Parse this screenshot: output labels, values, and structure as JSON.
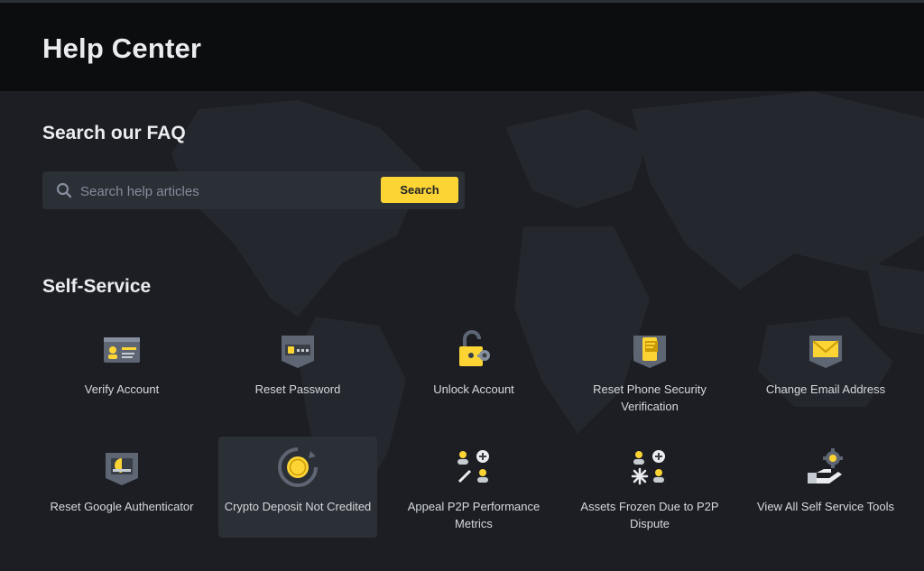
{
  "header": {
    "title": "Help Center"
  },
  "faq": {
    "title": "Search our FAQ",
    "search_placeholder": "Search help articles",
    "search_button": "Search"
  },
  "self_service": {
    "title": "Self-Service",
    "items": [
      {
        "label": "Verify Account",
        "icon": "id-card-icon"
      },
      {
        "label": "Reset Password",
        "icon": "password-card-icon"
      },
      {
        "label": "Unlock Account",
        "icon": "padlock-key-icon"
      },
      {
        "label": "Reset Phone Security Verification",
        "icon": "phone-shield-icon"
      },
      {
        "label": "Change Email Address",
        "icon": "envelope-shield-icon"
      },
      {
        "label": "Reset Google Authenticator",
        "icon": "authenticator-shield-icon"
      },
      {
        "label": "Crypto Deposit Not Credited",
        "icon": "coin-refresh-icon"
      },
      {
        "label": "Appeal P2P Performance Metrics",
        "icon": "p2p-users-icon"
      },
      {
        "label": "Assets Frozen Due to P2P Dispute",
        "icon": "frozen-assets-icon"
      },
      {
        "label": "View All Self Service Tools",
        "icon": "hand-gear-icon"
      }
    ]
  },
  "colors": {
    "accent": "#fcd535",
    "header_bg": "#0c0d0f",
    "page_bg": "#1c1e23",
    "tile_highlight": "#2b2f36"
  }
}
